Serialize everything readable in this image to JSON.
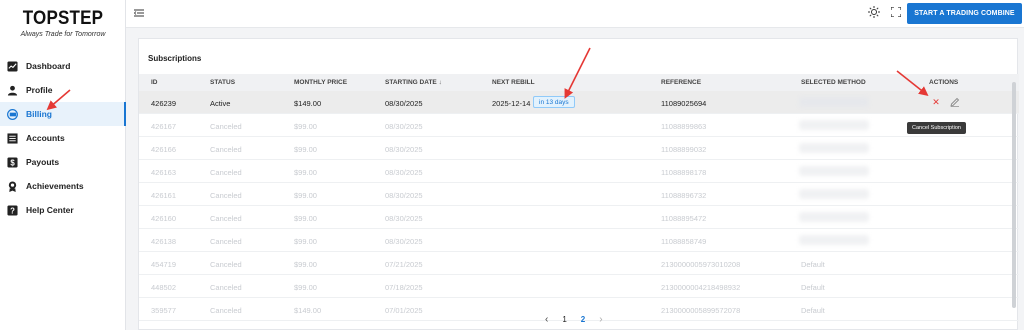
{
  "brand": {
    "name": "TOPSTEP",
    "tagline": "Always Trade for Tomorrow"
  },
  "sidebar": {
    "items": [
      {
        "label": "Dashboard",
        "icon": "chart-icon"
      },
      {
        "label": "Profile",
        "icon": "person-icon"
      },
      {
        "label": "Billing",
        "icon": "billing-icon",
        "active": true
      },
      {
        "label": "Accounts",
        "icon": "list-icon"
      },
      {
        "label": "Payouts",
        "icon": "dollar-icon"
      },
      {
        "label": "Achievements",
        "icon": "medal-icon"
      },
      {
        "label": "Help Center",
        "icon": "help-icon"
      }
    ]
  },
  "topbar": {
    "cta_label": "START A TRADING COMBINE"
  },
  "subscriptions": {
    "title": "Subscriptions",
    "columns": [
      "ID",
      "STATUS",
      "MONTHLY PRICE",
      "STARTING DATE",
      "NEXT REBILL",
      "REFERENCE",
      "SELECTED METHOD",
      "ACTIONS"
    ],
    "sort_icon": "arrow-down-icon",
    "rows": [
      {
        "id": "426239",
        "status": "Active",
        "price": "$149.00",
        "start": "08/30/2025",
        "rebill": "2025-12-14",
        "badge": "in 13 days",
        "reference": "11089025694",
        "method": ""
      },
      {
        "id": "426167",
        "status": "Canceled",
        "price": "$99.00",
        "start": "08/30/2025",
        "rebill": "",
        "badge": "",
        "reference": "11088899863",
        "method": ""
      },
      {
        "id": "426166",
        "status": "Canceled",
        "price": "$99.00",
        "start": "08/30/2025",
        "rebill": "",
        "badge": "",
        "reference": "11088899032",
        "method": ""
      },
      {
        "id": "426163",
        "status": "Canceled",
        "price": "$99.00",
        "start": "08/30/2025",
        "rebill": "",
        "badge": "",
        "reference": "11088898178",
        "method": ""
      },
      {
        "id": "426161",
        "status": "Canceled",
        "price": "$99.00",
        "start": "08/30/2025",
        "rebill": "",
        "badge": "",
        "reference": "11088896732",
        "method": ""
      },
      {
        "id": "426160",
        "status": "Canceled",
        "price": "$99.00",
        "start": "08/30/2025",
        "rebill": "",
        "badge": "",
        "reference": "11088895472",
        "method": ""
      },
      {
        "id": "426138",
        "status": "Canceled",
        "price": "$99.00",
        "start": "08/30/2025",
        "rebill": "",
        "badge": "",
        "reference": "11088858749",
        "method": ""
      },
      {
        "id": "454719",
        "status": "Canceled",
        "price": "$99.00",
        "start": "07/21/2025",
        "rebill": "",
        "badge": "",
        "reference": "2130000005973010208",
        "method": "Default"
      },
      {
        "id": "448502",
        "status": "Canceled",
        "price": "$99.00",
        "start": "07/18/2025",
        "rebill": "",
        "badge": "",
        "reference": "2130000004218498932",
        "method": "Default"
      },
      {
        "id": "359577",
        "status": "Canceled",
        "price": "$149.00",
        "start": "07/01/2025",
        "rebill": "",
        "badge": "",
        "reference": "2130000005899572078",
        "method": "Default"
      }
    ]
  },
  "tooltip": "Cancel Subscription",
  "pagination": {
    "pages": [
      "1",
      "2"
    ],
    "current": "2"
  },
  "colors": {
    "accent": "#1976d2",
    "danger": "#e53935",
    "annotation": "#e53935"
  }
}
